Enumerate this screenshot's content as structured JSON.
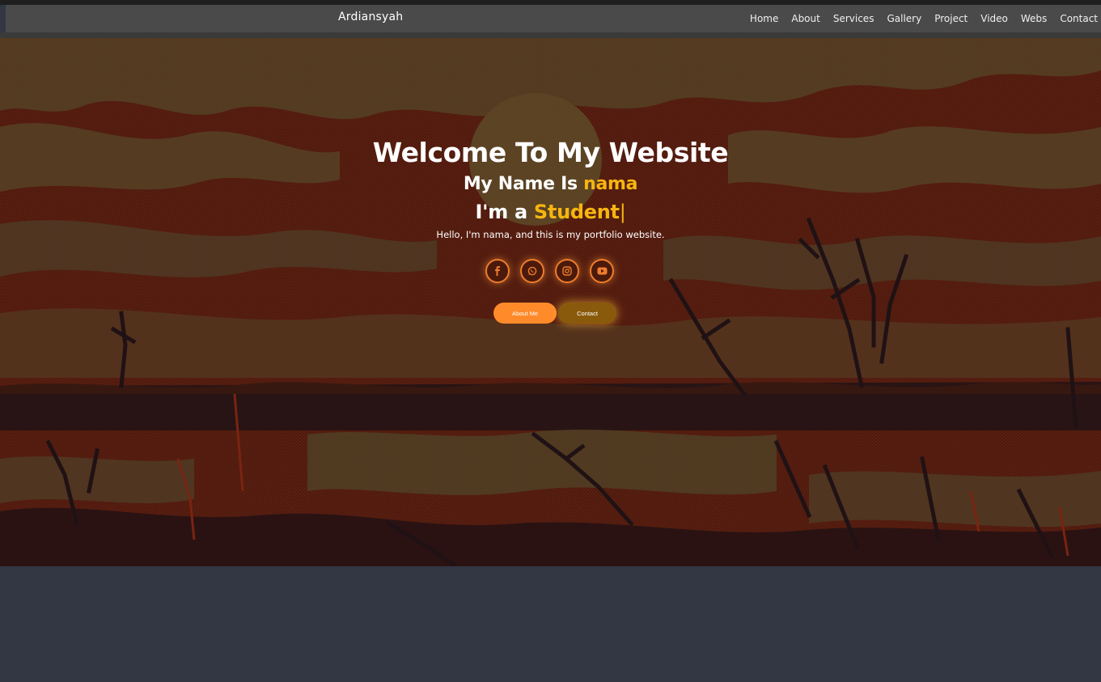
{
  "nav": {
    "brand": "Ardiansyah",
    "links": [
      "Home",
      "About",
      "Services",
      "Gallery",
      "Project",
      "Video",
      "Webs",
      "Contact"
    ]
  },
  "hero": {
    "headline": "Welcome To My Website",
    "name_prefix": "My Name Is ",
    "name": "nama",
    "role_prefix": "I'm a ",
    "role": "Student",
    "cursor": "|",
    "tagline": "Hello, I'm nama, and this is my portfolio website.",
    "socials": [
      {
        "icon": "facebook-icon"
      },
      {
        "icon": "whatsapp-icon"
      },
      {
        "icon": "instagram-icon"
      },
      {
        "icon": "youtube-icon"
      }
    ],
    "buttons": {
      "about": "About Me",
      "contact": "Contact"
    }
  },
  "colors": {
    "accent": "#f6b510",
    "button_orange": "#ff8a2a",
    "social_ring": "#f07c2c",
    "navbar": "#4a4a4a",
    "page_bg": "#323743"
  }
}
